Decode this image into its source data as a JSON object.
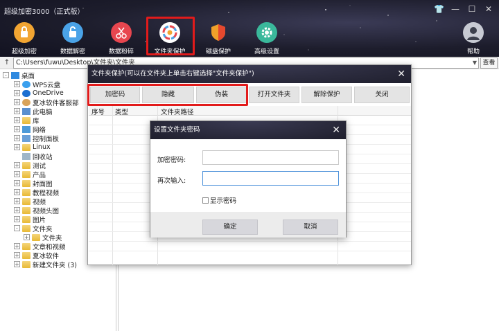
{
  "app": {
    "title": "超级加密3000（正式版）",
    "window_controls": [
      "shirt-icon",
      "minimize-icon",
      "maximize-icon",
      "close-icon"
    ]
  },
  "toolbar": {
    "items": [
      {
        "label": "超级加密",
        "icon": "lock-icon",
        "color": "#f2a532"
      },
      {
        "label": "数据解密",
        "icon": "unlock-icon",
        "color": "#4aa3e8"
      },
      {
        "label": "数据粉碎",
        "icon": "scissors-icon",
        "color": "#e8464f"
      },
      {
        "label": "文件夹保护",
        "icon": "folder-protect-icon",
        "color": "#ffffff",
        "highlighted": true
      },
      {
        "label": "磁盘保护",
        "icon": "shield-icon",
        "color": "#f0a12a"
      },
      {
        "label": "高级设置",
        "icon": "gear-icon",
        "color": "#3ab89b"
      },
      {
        "label": "帮助",
        "icon": "user-help-icon",
        "color": "#c7cad3"
      }
    ]
  },
  "address": {
    "up_label": "↑",
    "path": "C:\\Users\\fuwu\\Desktop\\文件夹\\文件夹",
    "view_label": "查看"
  },
  "tree": {
    "items": [
      {
        "label": "桌面",
        "icon": "desktop-icon",
        "expander": "-"
      },
      {
        "label": "WPS云盘",
        "icon": "cloud-icon",
        "expander": "+"
      },
      {
        "label": "OneDrive",
        "icon": "onedrive-icon",
        "expander": "+"
      },
      {
        "label": "夏冰软件客服部",
        "icon": "user-icon",
        "expander": "+"
      },
      {
        "label": "此电脑",
        "icon": "computer-icon",
        "expander": "+"
      },
      {
        "label": "库",
        "icon": "library-icon",
        "expander": "+"
      },
      {
        "label": "网络",
        "icon": "network-icon",
        "expander": "+"
      },
      {
        "label": "控制面板",
        "icon": "control-panel-icon",
        "expander": "+"
      },
      {
        "label": "Linux",
        "icon": "folder-icon",
        "expander": "+"
      },
      {
        "label": "回收站",
        "icon": "recycle-bin-icon",
        "expander": ""
      },
      {
        "label": "测试",
        "icon": "folder-icon",
        "expander": "+"
      },
      {
        "label": "产品",
        "icon": "folder-icon",
        "expander": "+"
      },
      {
        "label": "封面图",
        "icon": "folder-icon",
        "expander": "+"
      },
      {
        "label": "教程视频",
        "icon": "folder-icon",
        "expander": "+"
      },
      {
        "label": "视频",
        "icon": "folder-icon",
        "expander": "+"
      },
      {
        "label": "视频头图",
        "icon": "folder-icon",
        "expander": "+"
      },
      {
        "label": "图片",
        "icon": "folder-icon",
        "expander": "+"
      },
      {
        "label": "文件夹",
        "icon": "folder-icon",
        "expander": "-"
      },
      {
        "label": "文件夹",
        "icon": "folder-icon",
        "expander": "+"
      },
      {
        "label": "文章和视频",
        "icon": "folder-icon",
        "expander": "+"
      },
      {
        "label": "夏冰软件",
        "icon": "folder-icon",
        "expander": "+"
      },
      {
        "label": "新建文件夹 (3)",
        "icon": "folder-icon",
        "expander": "+"
      }
    ]
  },
  "folder_dialog": {
    "title": "文件夹保护(可以在文件夹上单击右键选择\"文件夹保护\")",
    "buttons": [
      "加密码",
      "隐藏",
      "伪装",
      "打开文件夹",
      "解除保护",
      "关闭"
    ],
    "columns": [
      "序号",
      "类型",
      "文件夹路径"
    ]
  },
  "password_dialog": {
    "title": "设置文件夹密码",
    "label_password": "加密密码:",
    "label_confirm": "再次输入:",
    "password_value": "",
    "confirm_value": "",
    "show_password_label": "显示密码",
    "ok_label": "确定",
    "cancel_label": "取消"
  },
  "colors": {
    "highlight_red": "#e21b1b",
    "dialog_title_bg": "#23233a",
    "focus_blue": "#4a90d9"
  }
}
